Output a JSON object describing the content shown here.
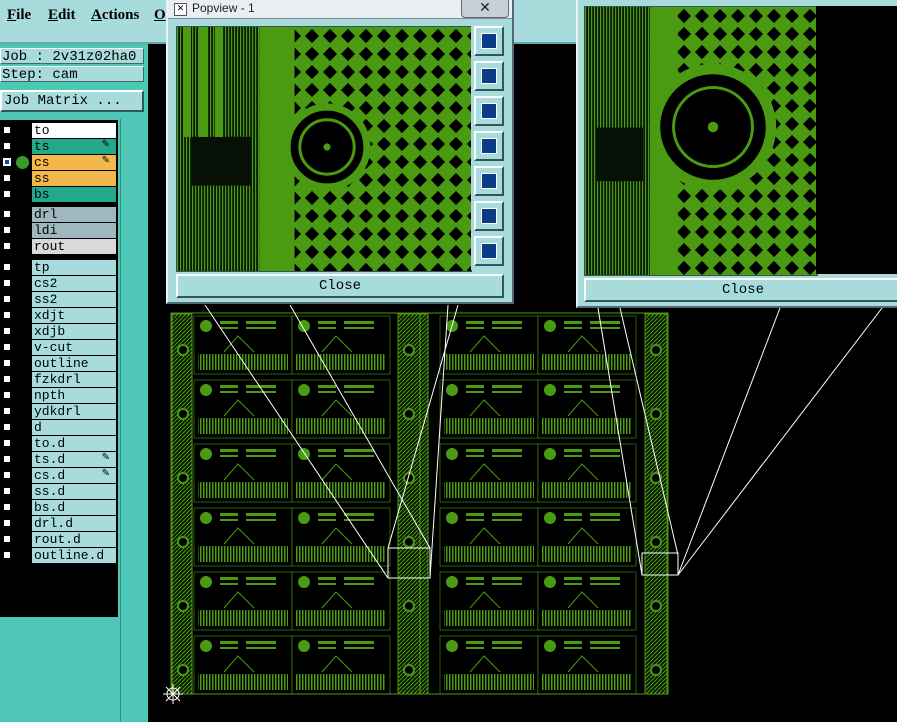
{
  "menu": {
    "items": [
      {
        "underline": "F",
        "rest": "ile"
      },
      {
        "underline": "E",
        "rest": "dit"
      },
      {
        "underline": "A",
        "rest": "ctions"
      },
      {
        "underline": "O",
        "rest": ""
      }
    ]
  },
  "job": {
    "job_line": "Job : 2v31z02ha0",
    "step_line": "Step: cam",
    "matrix_label": "Job Matrix ..."
  },
  "layers": {
    "group1": [
      {
        "name": "to",
        "color": "#ffffff",
        "checked": false,
        "dot": false,
        "mark": ""
      },
      {
        "name": "ts",
        "color": "#23a88a",
        "checked": false,
        "dot": false,
        "mark": "✎"
      },
      {
        "name": "cs",
        "color": "#f2b84b",
        "checked": true,
        "dot": true,
        "mark": "✎"
      },
      {
        "name": "ss",
        "color": "#f2b84b",
        "checked": false,
        "dot": false,
        "mark": ""
      },
      {
        "name": "bs",
        "color": "#23a88a",
        "checked": false,
        "dot": false,
        "mark": ""
      }
    ],
    "group2": [
      {
        "name": "drl",
        "color": "#9fb8c0",
        "checked": false
      },
      {
        "name": "ldi",
        "color": "#9fb8c0",
        "checked": false
      },
      {
        "name": "rout",
        "color": "#d9d9d9",
        "checked": false
      }
    ],
    "group3": [
      {
        "name": "tp",
        "mark": ""
      },
      {
        "name": "cs2",
        "mark": ""
      },
      {
        "name": "ss2",
        "mark": ""
      },
      {
        "name": "xdjt",
        "mark": ""
      },
      {
        "name": "xdjb",
        "mark": ""
      },
      {
        "name": "v-cut",
        "mark": ""
      },
      {
        "name": "outline",
        "mark": ""
      },
      {
        "name": "fzkdrl",
        "mark": ""
      },
      {
        "name": "npth",
        "mark": ""
      },
      {
        "name": "ydkdrl",
        "mark": ""
      },
      {
        "name": "d",
        "mark": ""
      },
      {
        "name": "to.d",
        "mark": ""
      },
      {
        "name": "ts.d",
        "mark": "✎"
      },
      {
        "name": "cs.d",
        "mark": "✎"
      },
      {
        "name": "ss.d",
        "mark": ""
      },
      {
        "name": "bs.d",
        "mark": ""
      },
      {
        "name": "drl.d",
        "mark": ""
      },
      {
        "name": "rout.d",
        "mark": ""
      },
      {
        "name": "outline.d",
        "mark": ""
      }
    ]
  },
  "popview1": {
    "title": "Popview - 1",
    "close_x": "✕",
    "close_label": "Close"
  },
  "popview2": {
    "close_label": "Close"
  },
  "colors": {
    "pcb_green": "#4a9a12",
    "pcb_dark": "#0a1a06",
    "ui_teal": "#a8dcdc",
    "panel_teal": "#4fc7b7"
  },
  "icons": {
    "cursor_crosshair": "target-crosshair-icon"
  }
}
